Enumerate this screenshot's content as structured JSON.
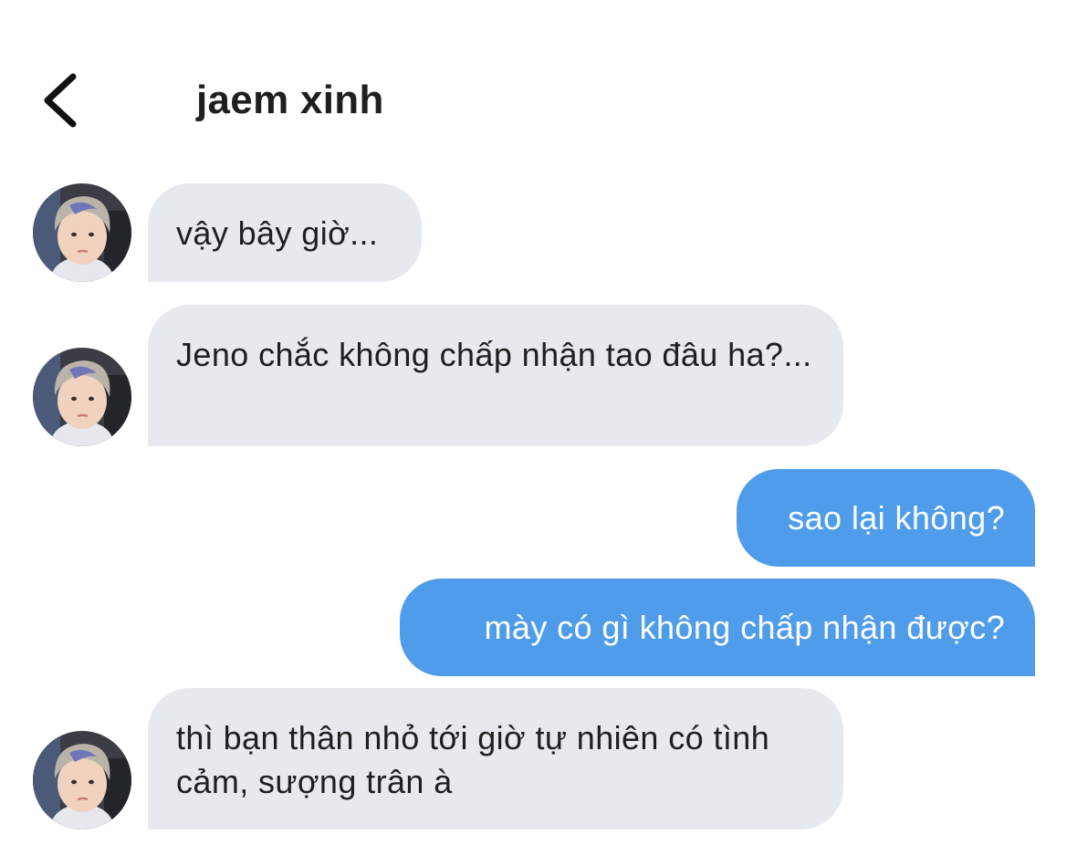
{
  "header": {
    "back_icon": "chevron-left-icon",
    "title": "jaem xinh"
  },
  "colors": {
    "incoming_bubble": "#e6e9ee",
    "outgoing_bubble": "#4f9dea",
    "incoming_text": "#1f1f1f",
    "outgoing_text": "#ffffff"
  },
  "messages": [
    {
      "direction": "in",
      "text": "vậy bây giờ..."
    },
    {
      "direction": "in",
      "text": "Jeno chắc không chấp nhận tao đâu ha?..."
    },
    {
      "direction": "out",
      "text": "sao lại không?"
    },
    {
      "direction": "out",
      "text": "mày có gì không chấp nhận được?"
    },
    {
      "direction": "in",
      "text": "thì bạn thân nhỏ tới giờ tự nhiên có tình cảm, sượng trân à"
    }
  ]
}
